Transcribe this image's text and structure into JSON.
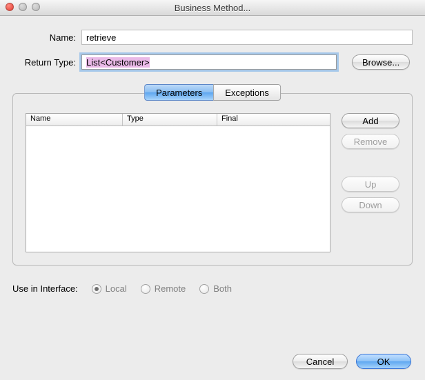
{
  "window": {
    "title": "Business Method..."
  },
  "fields": {
    "name_label": "Name:",
    "name_value": "retrieve",
    "return_label": "Return Type:",
    "return_value": "List<Customer>",
    "browse_label": "Browse..."
  },
  "tabs": {
    "parameters": "Parameters",
    "exceptions": "Exceptions",
    "active": "parameters"
  },
  "table": {
    "columns": {
      "name": "Name",
      "type": "Type",
      "final": "Final"
    },
    "rows": []
  },
  "side_buttons": {
    "add": "Add",
    "remove": "Remove",
    "up": "Up",
    "down": "Down"
  },
  "interface": {
    "label": "Use in Interface:",
    "local": "Local",
    "remote": "Remote",
    "both": "Both",
    "selected": "local"
  },
  "footer": {
    "cancel": "Cancel",
    "ok": "OK"
  }
}
